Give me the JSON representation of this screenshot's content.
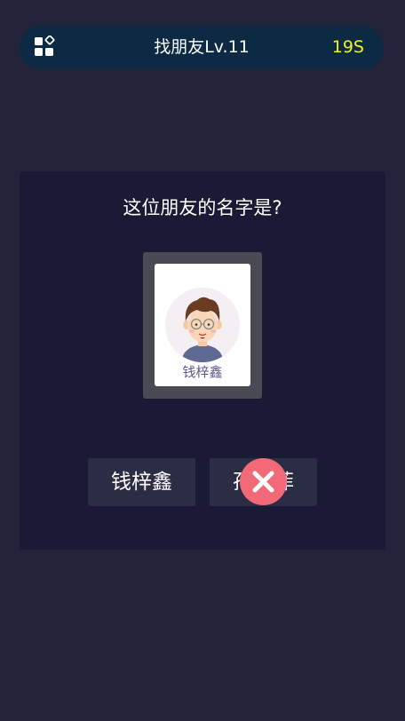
{
  "header": {
    "menu_icon": "grid-apps-icon",
    "title": "找朋友Lv.11",
    "timer": "19S",
    "timer_color": "#f2f21e"
  },
  "quiz": {
    "question": "这位朋友的名字是?",
    "card": {
      "avatar_icon": "cartoon-boy-with-glasses",
      "name": "钱梓鑫"
    },
    "options": [
      {
        "label": "钱梓鑫"
      },
      {
        "label": "孙宇菲"
      }
    ],
    "wrong_mark_icon": "close-icon",
    "wrong_mark_color": "#f26a78"
  }
}
